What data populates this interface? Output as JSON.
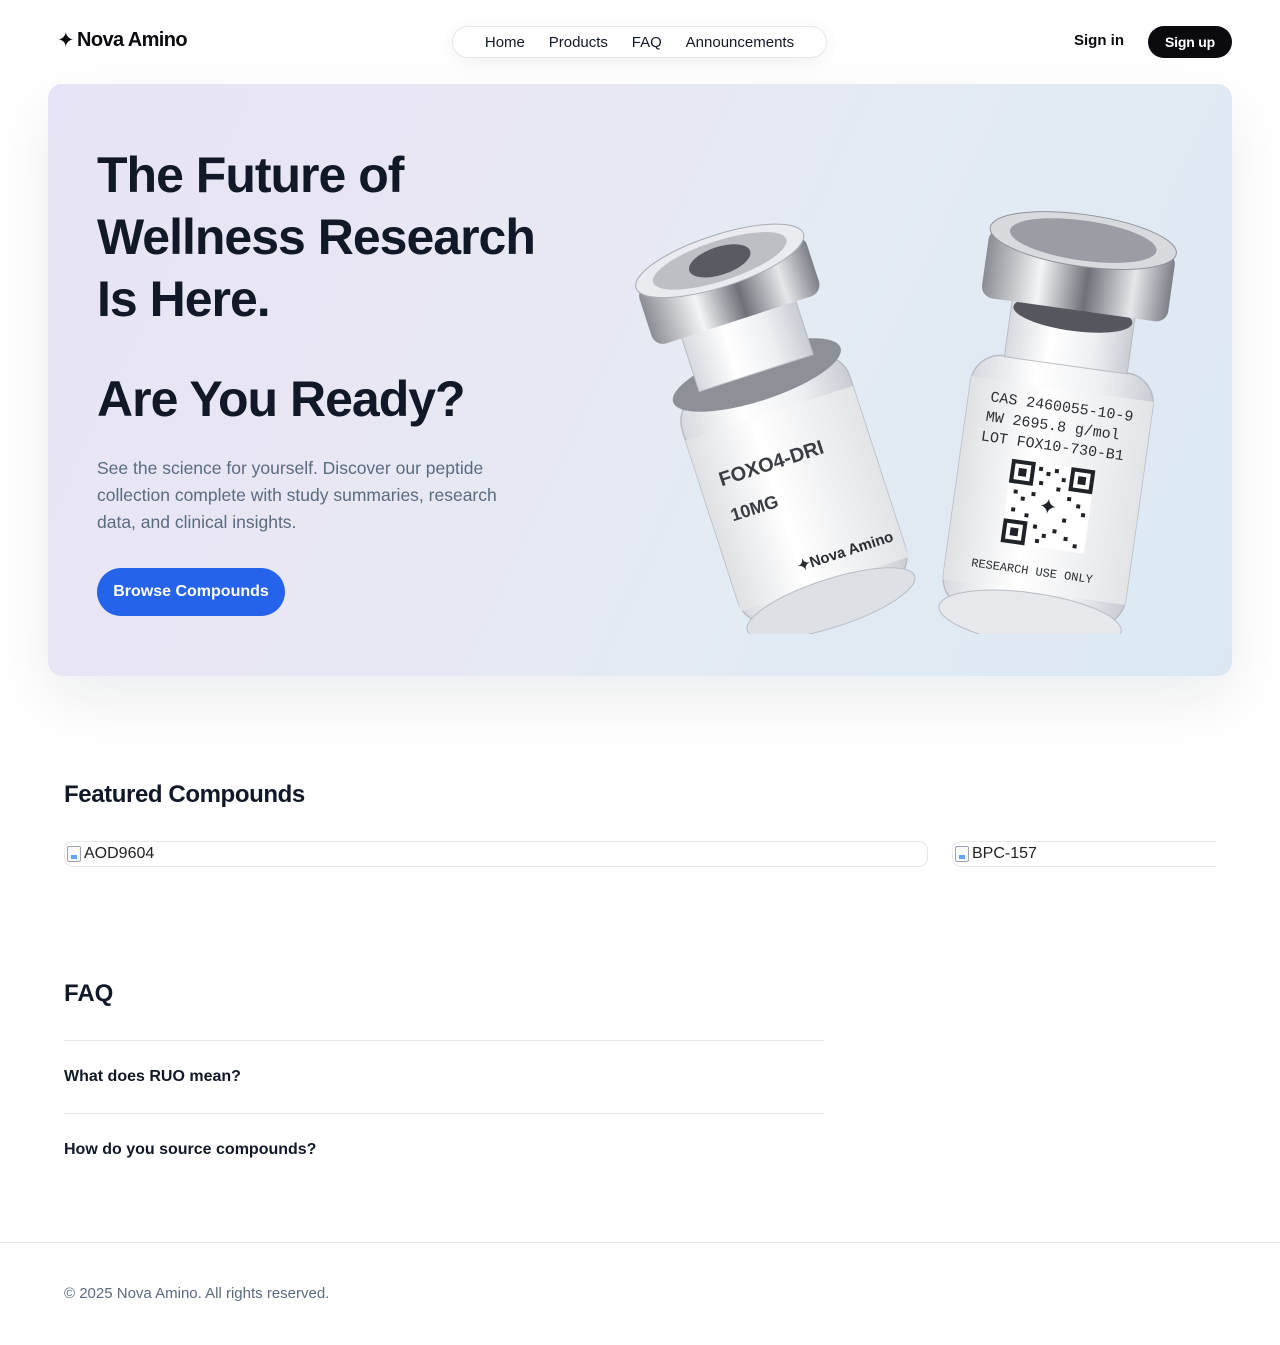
{
  "brand": {
    "name": "Nova Amino",
    "star": "✦"
  },
  "nav": {
    "items": [
      "Home",
      "Products",
      "FAQ",
      "Announcements"
    ]
  },
  "auth": {
    "signin": "Sign in",
    "signup": "Sign up"
  },
  "hero": {
    "title": "The Future of Wellness Research Is Here.",
    "subtitle": "Are You Ready?",
    "description": "See the science for yourself. Discover our peptide collection complete with study summaries, research data, and clinical insights.",
    "cta": "Browse Compounds",
    "vial_left": {
      "name": "FOXO4-DRI",
      "dose": "10MG",
      "brand": "✦Nova Amino"
    },
    "vial_right": {
      "cas": "CAS 2460055-10-9",
      "mw": "MW 2695.8 g/mol",
      "lot": "LOT FOX10-730-B1",
      "note": "RESEARCH USE ONLY"
    }
  },
  "featured": {
    "title": "Featured Compounds",
    "items": [
      {
        "alt": "AOD9604"
      },
      {
        "alt": "BPC-157"
      }
    ]
  },
  "faq": {
    "title": "FAQ",
    "items": [
      "What does RUO mean?",
      "How do you source compounds?"
    ]
  },
  "footer": {
    "copyright": "© 2025 Nova Amino. All rights reserved."
  },
  "colors": {
    "accent": "#2563eb",
    "dark": "#0b0b0f",
    "muted": "#5b6b80"
  }
}
